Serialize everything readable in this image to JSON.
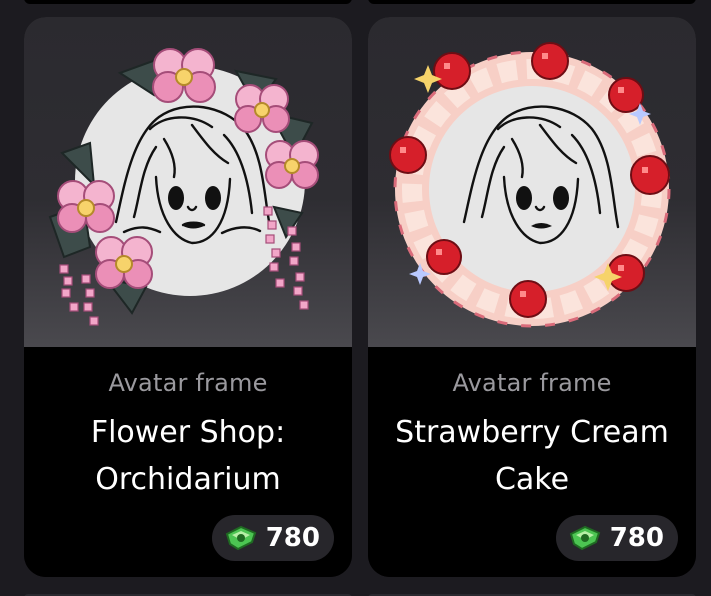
{
  "items": [
    {
      "category": "Avatar frame",
      "name_line1": "Flower Shop:",
      "name_line2": "Orchidarium",
      "price": "780",
      "currency_icon": "green-gem-icon",
      "frame_icon": "orchid-flower-frame",
      "accent": "#f2a6c8"
    },
    {
      "category": "Avatar frame",
      "name_line1": "Strawberry Cream",
      "name_line2": "Cake",
      "price": "780",
      "currency_icon": "green-gem-icon",
      "frame_icon": "strawberry-cream-frame",
      "accent": "#d61f2a"
    }
  ],
  "colors": {
    "page_background": "#1c1b20",
    "card_info_background": "#000000",
    "price_pill": "#27262b",
    "category_text": "#9a999e",
    "title_text": "#ffffff",
    "gem": "#4cc552"
  }
}
